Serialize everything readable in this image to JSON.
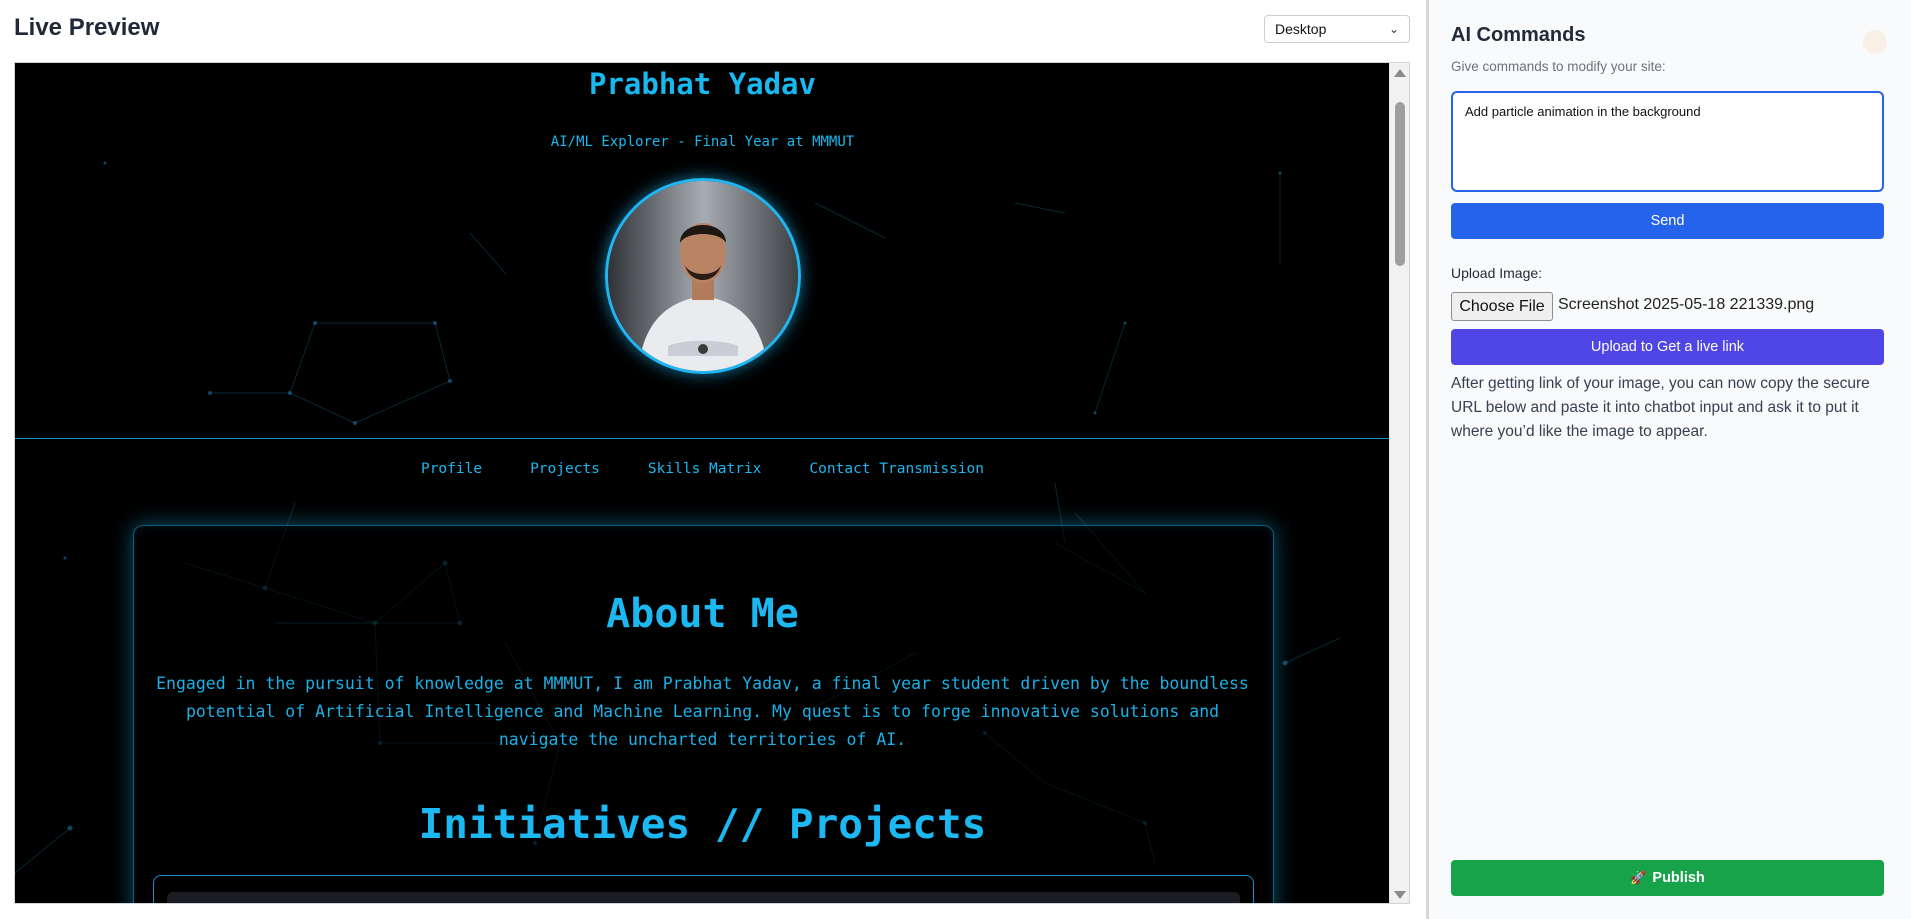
{
  "preview": {
    "title": "Live Preview",
    "device_options": [
      "Desktop"
    ],
    "device_selected": "Desktop"
  },
  "site": {
    "name": "Prabhat Yadav",
    "subtitle": "AI/ML Explorer - Final Year at MMMUT",
    "nav": [
      "Profile",
      "Projects",
      "Skills Matrix",
      "Contact Transmission"
    ],
    "about_heading": "About Me",
    "about_text": "Engaged in the pursuit of knowledge at MMMUT, I am Prabhat Yadav, a final year student driven by the boundless potential of Artificial Intelligence and Machine Learning. My quest is to forge innovative solutions and navigate the uncharted territories of AI.",
    "projects_heading": "Initiatives // Projects"
  },
  "colors": {
    "accent_cyan": "#18b8f0",
    "send_blue": "#2563eb",
    "upload_purple": "#4f46e5",
    "publish_green": "#16a34a"
  },
  "ai": {
    "title": "AI Commands",
    "hint": "Give commands to modify your site:",
    "command_value": "Add particle animation in the background",
    "send_label": "Send",
    "upload_label": "Upload Image:",
    "choose_file_label": "Choose File",
    "file_name": "Screenshot 2025-05-18 221339.png",
    "upload_button_label": "Upload to Get a live link",
    "upload_note": "After getting link of your image, you can now copy the secure URL below and paste it into chatbot input and ask it to put it where you’d like the image to appear.",
    "publish_label": "Publish",
    "publish_icon": "rocket-icon"
  }
}
